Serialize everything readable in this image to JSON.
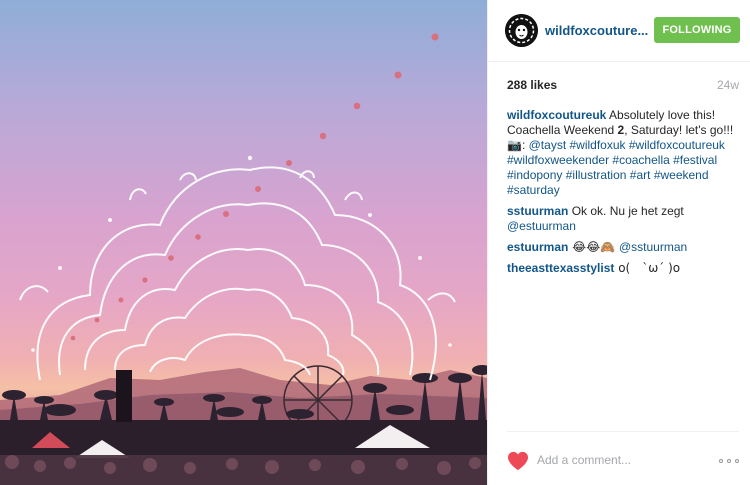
{
  "post": {
    "username": "wildfoxcouture...",
    "follow_label": "FOLLOWING",
    "likes": "288 likes",
    "age": "24w",
    "caption": {
      "user": "wildfoxcoutureuk",
      "text1": " Absolutely love this! Coachella Weekend ",
      "bold": "2",
      "text2": ", Saturday! let's go!!! ",
      "camera": "📷",
      "colon": ": ",
      "tags": [
        "@tayst",
        "#wildfoxuk",
        "#wildfoxcoutureuk",
        "#wildfoxweekender",
        "#coachella",
        "#festival",
        "#indopony",
        "#illustration",
        "#art",
        "#weekend",
        "#saturday"
      ]
    },
    "comments": [
      {
        "user": "sstuurman",
        "text": " Ok ok. Nu je het zegt ",
        "mention": "@estuurman"
      },
      {
        "user": "estuurman",
        "emoji": " 😂😂🙈 ",
        "mention": "@sstuurman"
      },
      {
        "user": "theeasttexasstylist",
        "text": " o(　`ω´ )o"
      }
    ],
    "comment_placeholder": "Add a comment...",
    "colors": {
      "link": "#125688",
      "follow": "#70c050",
      "heart": "#ed4956",
      "muted": "#a5a7aa"
    },
    "icons": [
      "heart-icon",
      "more-options-icon",
      "lion-avatar-icon"
    ]
  }
}
